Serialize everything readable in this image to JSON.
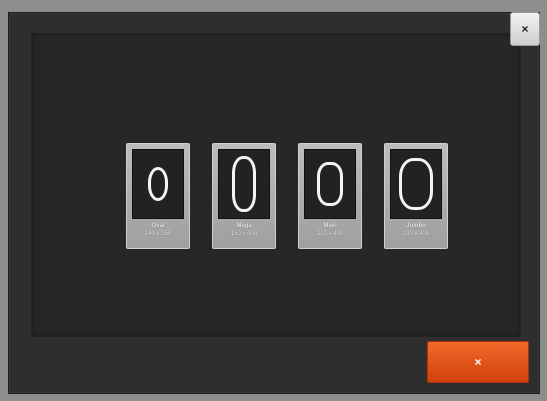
{
  "dialog": {
    "close_glyph": "×",
    "cancel_glyph": "×",
    "accent_color": "#e0521a"
  },
  "hoops": [
    {
      "name": "Oval",
      "size": "140 x 250"
    },
    {
      "name": "Mega",
      "size": "150 x 400"
    },
    {
      "name": "Maxi",
      "size": "210 x 400"
    },
    {
      "name": "Jumbo",
      "size": "230 x 400"
    }
  ]
}
